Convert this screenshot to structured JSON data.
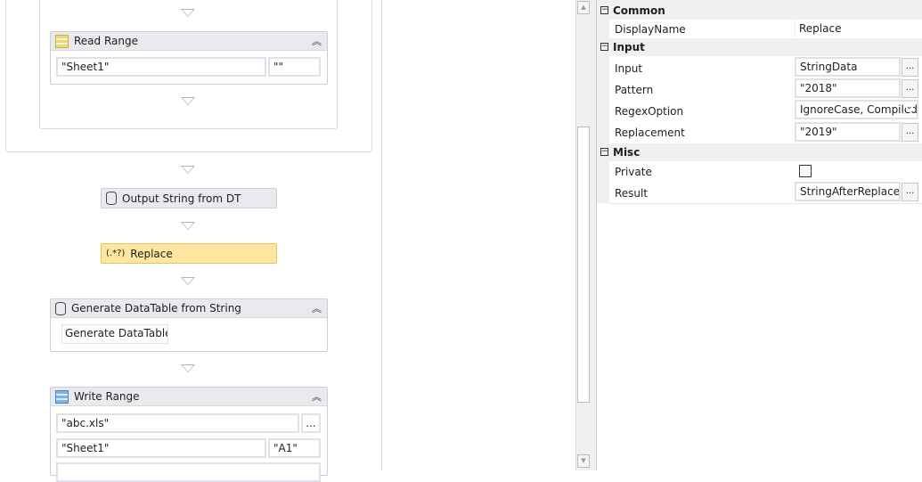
{
  "designer": {
    "read_range": {
      "title": "Read Range",
      "sheet": "\"Sheet1\"",
      "range": "\"\""
    },
    "output_string": {
      "title": "Output String from DT"
    },
    "replace": {
      "title": "Replace",
      "icon_text": "(.*?)"
    },
    "generate_dt": {
      "title": "Generate DataTable from String",
      "button": "Generate DataTable..."
    },
    "write_range": {
      "title": "Write Range",
      "file": "\"abc.xls\"",
      "browse": "...",
      "sheet": "\"Sheet1\"",
      "cell": "\"A1\""
    }
  },
  "properties": {
    "categories": {
      "common": "Common",
      "input": "Input",
      "misc": "Misc"
    },
    "rows": {
      "display_name": {
        "label": "DisplayName",
        "value": "Replace"
      },
      "input": {
        "label": "Input",
        "value": "StringData"
      },
      "pattern": {
        "label": "Pattern",
        "value": "\"2018\""
      },
      "regex_option": {
        "label": "RegexOption",
        "value": "IgnoreCase, Compiled"
      },
      "replacement": {
        "label": "Replacement",
        "value": "\"2019\""
      },
      "private": {
        "label": "Private",
        "checked": false
      },
      "result": {
        "label": "Result",
        "value": "StringAfterReplace"
      }
    },
    "ellipsis": "..."
  },
  "colors": {
    "replace_bg": "#fde7a0",
    "header_bg": "#e8eaee"
  }
}
